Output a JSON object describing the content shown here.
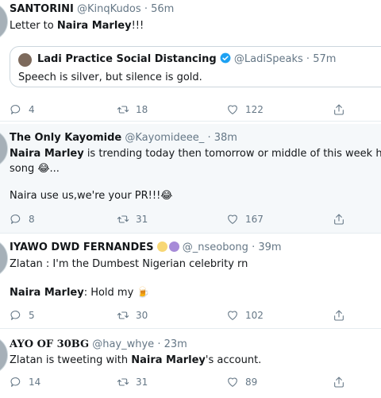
{
  "tweets": [
    {
      "name": "SANTORINI",
      "handle": "@KinqKudos",
      "sep": "·",
      "time": "56m",
      "text_prefix": "Letter to ",
      "text_bold": "Naira Marley",
      "text_suffix": "!!!",
      "quote": {
        "name": "Ladi Practice Social Distancing",
        "handle": "@LadiSpeaks",
        "sep": "·",
        "time": "57m",
        "text": "Speech is silver, but silence is gold."
      },
      "replies": "4",
      "retweets": "18",
      "likes": "122"
    },
    {
      "name": "The Only Kayomide",
      "handle": "@Kayomideee_",
      "sep": "·",
      "time": "38m",
      "line1_bold": "Naira Marley",
      "line1_rest": " is trending today then tomorrow or middle of this week he'll drop",
      "line2": "song 😂...",
      "line3": "Naira use us,we're your PR!!!😂",
      "replies": "8",
      "retweets": "31",
      "likes": "167"
    },
    {
      "name": "IYAWO DWD FERNANDES",
      "handle": "@_nseobong",
      "sep": "·",
      "time": "39m",
      "line1": "Zlatan : I'm the Dumbest Nigerian celebrity rn",
      "line2_bold": "Naira Marley",
      "line2_rest": ": Hold my 🍺",
      "replies": "5",
      "retweets": "30",
      "likes": "102"
    },
    {
      "name": "AYO OF 30BG",
      "handle": "@hay_whye",
      "sep": "·",
      "time": "23m",
      "text_prefix": "Zlatan is tweeting with ",
      "text_bold": "Naira Marley",
      "text_suffix": "'s account.",
      "replies": "14",
      "retweets": "31",
      "likes": "89"
    }
  ],
  "colors": {
    "text": "#14171a",
    "secondary": "#657786",
    "highlight_bg": "#f5f8fa",
    "verified": "#1da1f2",
    "border": "#e6ecf0"
  },
  "icons": [
    "reply-icon",
    "retweet-icon",
    "like-icon",
    "share-icon",
    "verified-badge-icon"
  ]
}
